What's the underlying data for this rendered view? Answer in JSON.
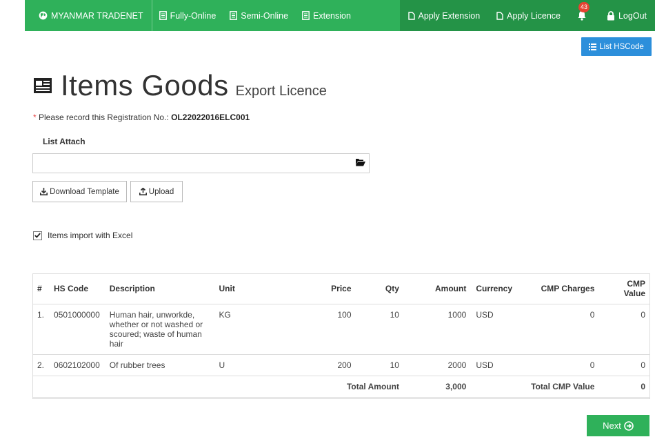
{
  "nav": {
    "brand": "MYANMAR TRADENET",
    "items": [
      "Fully-Online",
      "Semi-Online",
      "Extension"
    ],
    "right": {
      "apply_extension": "Apply Extension",
      "apply_licence": "Apply Licence",
      "notification_count": "43",
      "logout": "LogOut"
    }
  },
  "list_hscode_label": "List HSCode",
  "title": {
    "main": "Items Goods",
    "sub": "Export Licence"
  },
  "registration": {
    "star": "*",
    "prefix": "Please record this Registration No.:",
    "number": "OL22022016ELC001"
  },
  "attach": {
    "label": "List Attach",
    "value": ""
  },
  "buttons": {
    "download": "Download Template",
    "upload": "Upload",
    "next": "Next"
  },
  "import_excel": {
    "label": "Items import with Excel",
    "checked": true
  },
  "table": {
    "headers": [
      "#",
      "HS Code",
      "Description",
      "Unit",
      "Price",
      "Qty",
      "Amount",
      "Currency",
      "CMP Charges",
      "CMP Value"
    ],
    "rows": [
      {
        "no": "1.",
        "hs": "0501000000",
        "desc": "Human hair, unworkde, whether or not washed or scoured; waste of human hair",
        "unit": "KG",
        "price": "100",
        "qty": "10",
        "amount": "1000",
        "currency": "USD",
        "cmp_charges": "0",
        "cmp_value": "0"
      },
      {
        "no": "2.",
        "hs": "0602102000",
        "desc": "Of rubber trees",
        "unit": "U",
        "price": "200",
        "qty": "10",
        "amount": "2000",
        "currency": "USD",
        "cmp_charges": "0",
        "cmp_value": "0"
      }
    ],
    "totals": {
      "total_amount_label": "Total Amount",
      "total_amount": "3,000",
      "total_cmp_label": "Total CMP Value",
      "total_cmp": "0"
    }
  },
  "colors": {
    "nav_green": "#2fb15a",
    "nav_dark_green": "#249347",
    "blue_button": "#2c8fdb",
    "badge_red": "#e64331"
  }
}
